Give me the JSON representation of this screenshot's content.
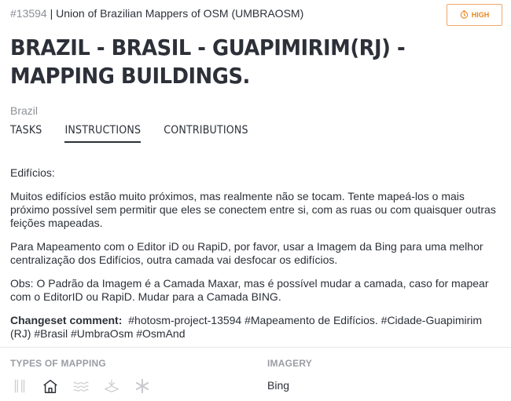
{
  "header": {
    "project_id": "#13594",
    "separator": " | ",
    "organisation": "Union of Brazilian Mappers of OSM (UMBRAOSM)",
    "priority": "HIGH",
    "priority_color": "#e8871e"
  },
  "project": {
    "title": "BRAZIL - BRASIL - GUAPIMIRIM(RJ) - MAPPING BUILDINGS.",
    "country": "Brazil"
  },
  "tabs": [
    {
      "label": "TASKS",
      "active": false
    },
    {
      "label": "INSTRUCTIONS",
      "active": true
    },
    {
      "label": "CONTRIBUTIONS",
      "active": false
    }
  ],
  "instructions": {
    "p1": "Edifícios:",
    "p2": "Muitos edifícios estão muito próximos, mas realmente não se tocam. Tente mapeá-los o mais próximo possível sem permitir que eles se conectem entre si, com as ruas ou com quaisquer outras feições mapeadas.",
    "p3": "Para Mapeamento com o Editor iD ou RapiD, por favor, usar a Imagem da Bing para uma melhor centralização dos Edifícios, outra camada vai desfocar os edifícios.",
    "p4": "Obs: O Padrão da Imagem é a Camada Maxar, mas é possível mudar a camada, caso for mapear com o EditorID ou RapiD. Mudar para a Camada BING.",
    "changeset_label": "Changeset comment:",
    "changeset_value": "#hotosm-project-13594 #Mapeamento de Edifícios. #Cidade-Guapimirim (RJ) #Brasil #UmbraOsm #OsmAnd"
  },
  "mapping": {
    "label": "TYPES OF MAPPING",
    "icons": [
      "roads-icon",
      "buildings-icon",
      "waterways-icon",
      "land-use-icon",
      "other-icon"
    ],
    "active_icon": "buildings-icon"
  },
  "imagery": {
    "label": "IMAGERY",
    "value": "Bing"
  }
}
